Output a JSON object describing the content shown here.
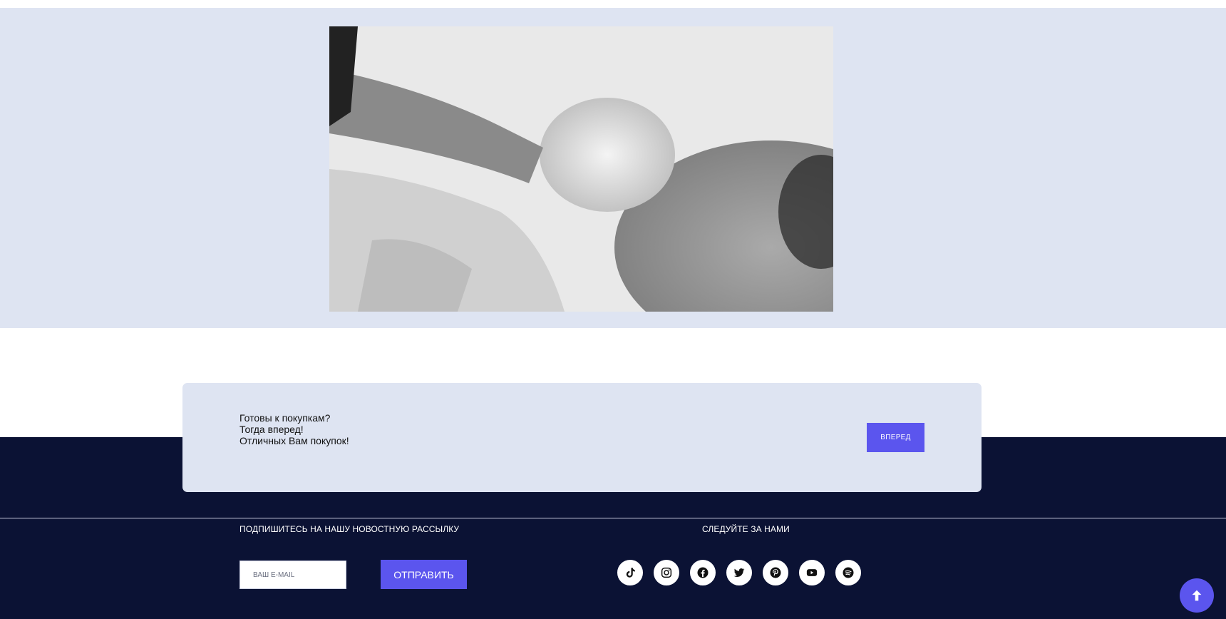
{
  "cta": {
    "lines": [
      "Готовы к покупкам?",
      "Тогда вперед!",
      "Отличных Вам покупок!"
    ],
    "button_label": "ВПЕРЕД"
  },
  "footer": {
    "newsletter_title": "ПОДПИШИТЕСЬ НА НАШУ НОВОСТНУЮ РАССЫЛКУ",
    "email_placeholder": "ВАШ E-MAIL",
    "submit_label": "ОТПРАВИТЬ",
    "follow_title": "СЛЕДУЙТЕ ЗА НАМИ",
    "social_icons": [
      "tiktok-icon",
      "instagram-icon",
      "facebook-icon",
      "twitter-icon",
      "pinterest-icon",
      "youtube-icon",
      "spotify-icon"
    ]
  },
  "colors": {
    "accent": "#5b55ee",
    "hero_bg": "#dee4f2",
    "footer_bg": "#0b1234"
  }
}
